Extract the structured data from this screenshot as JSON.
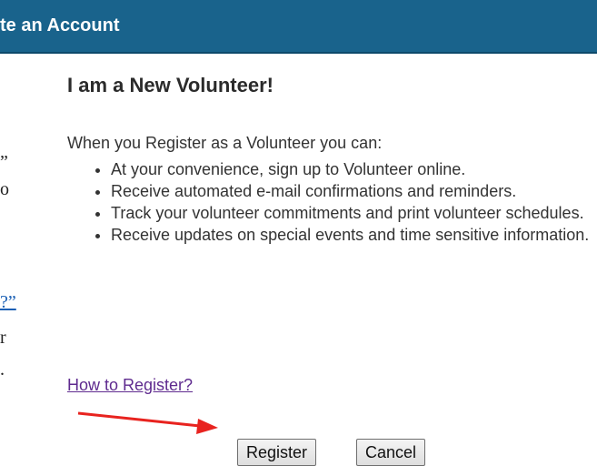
{
  "header": {
    "title": "te an Account"
  },
  "left_column_fragments": {
    "frag1": "”",
    "frag2": "o",
    "frag3": "?”",
    "frag4": "r",
    "frag5": "."
  },
  "main": {
    "title": "I am a New Volunteer!",
    "intro": "When you Register as a Volunteer you can:",
    "benefits": [
      "At your convenience, sign up to Volunteer online.",
      "Receive automated e-mail confirmations and reminders.",
      "Track your volunteer commitments and print volunteer schedules.",
      "Receive updates on special events and time sensitive information."
    ],
    "how_to_link": "How to Register?"
  },
  "buttons": {
    "register": "Register",
    "cancel": "Cancel"
  },
  "annotation": {
    "arrow_color": "#e8231f"
  },
  "colors": {
    "header_bg": "#19638c",
    "link_visited": "#5f2b8f"
  }
}
